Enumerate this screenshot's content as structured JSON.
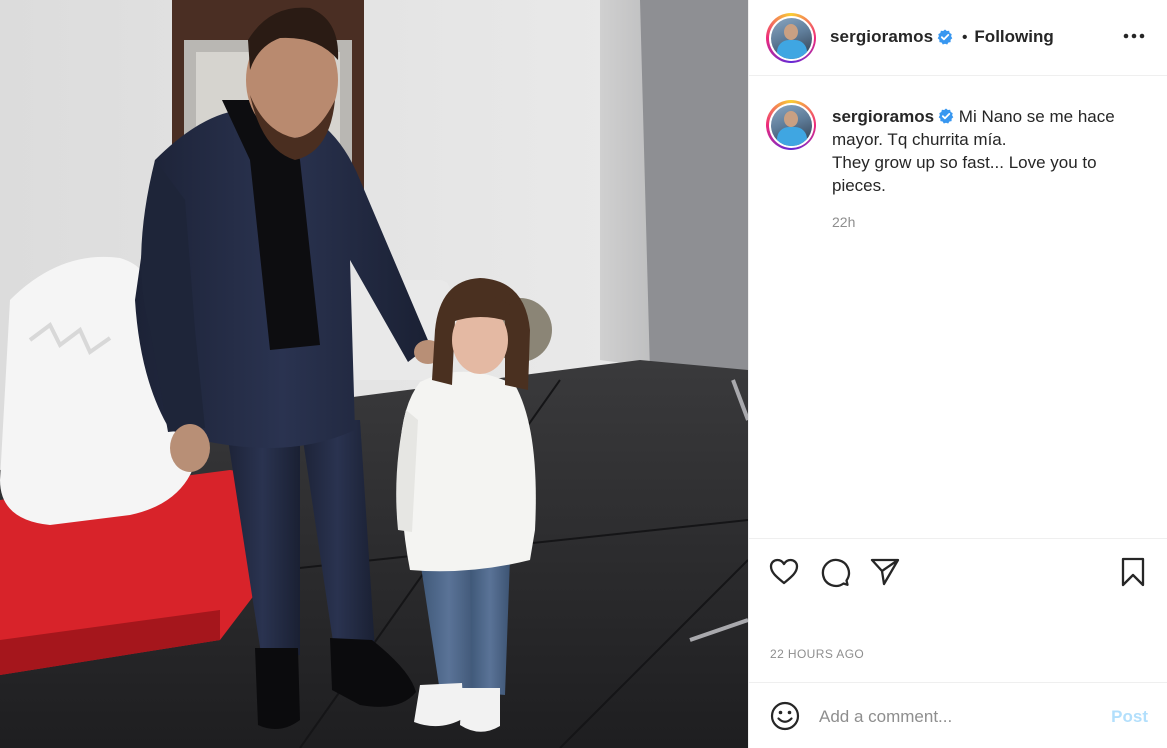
{
  "post": {
    "username": "sergioramos",
    "separator": "•",
    "follow_status": "Following",
    "caption_line1": "Mi Nano se me hace mayor. Tq churrita mía.",
    "caption_line2": "They grow up so fast... Love you to pieces.",
    "caption_time": "22h",
    "timestamp": "22 HOURS AGO"
  },
  "comment": {
    "placeholder": "Add a comment...",
    "post_label": "Post"
  },
  "icons": {
    "more": "more-options-icon",
    "verified": "verified-badge-icon",
    "like": "heart-icon",
    "comment": "comment-icon",
    "share": "send-icon",
    "save": "bookmark-icon",
    "emoji": "emoji-icon"
  },
  "colors": {
    "verified": "#3897f0",
    "post_button_disabled": "#b2dffc",
    "secondary_text": "#8e8e8e"
  }
}
